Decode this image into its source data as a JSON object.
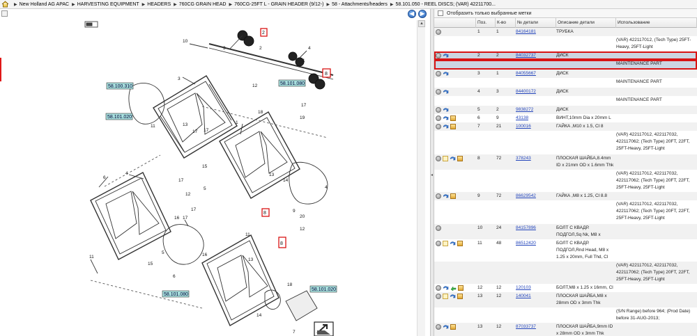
{
  "breadcrumb": [
    "New Holland AG APAC",
    "HARVESTING EQUIPMENT",
    "HEADERS",
    "760CG GRAIN HEAD",
    "760CG-25FT L - GRAIN HEADER (9/12-)",
    "58 - Attachments/headers",
    "58.101.050 - REEL DISCS; (VAR) 42211700..."
  ],
  "nav": {
    "back": "◀",
    "forward": "▶"
  },
  "diagram": {
    "refs": [
      "58.100.310",
      "58.101.080",
      "58.101.020",
      "58.101.080",
      "58.101.020"
    ],
    "callouts": [
      "2",
      "8",
      "8",
      "8"
    ],
    "numbers": [
      "10",
      "3",
      "2",
      "4",
      "1",
      "3",
      "1",
      "18",
      "19",
      "11",
      "13",
      "17",
      "12",
      "17",
      "17",
      "15",
      "5",
      "13",
      "14",
      "4",
      "6",
      "17",
      "12",
      "17",
      "17",
      "16",
      "5",
      "11",
      "6",
      "16",
      "15",
      "11",
      "20",
      "4",
      "18",
      "9",
      "12",
      "13",
      "14",
      "7"
    ]
  },
  "filter": {
    "label": "Отобразить только выбранные метки"
  },
  "columns": [
    "Поз.",
    "К-во",
    "№ детали",
    "Описание детали",
    "Использование"
  ],
  "rows": [
    {
      "pos": "1",
      "qty": "1",
      "pn": "84164181",
      "desc": "ТРУБКА",
      "use": "",
      "icons": [
        "grey"
      ],
      "h": 12,
      "bg": "r0"
    },
    {
      "pos": "",
      "qty": "",
      "pn": "",
      "desc": "",
      "use": "(VAR) 422117012, (Tech Type) 25FT-Heavy, 25FT-Light",
      "icons": [],
      "h": 22,
      "bg": "r1"
    },
    {
      "pos": "2",
      "qty": "2",
      "pn": "84032737",
      "desc": "ДИСК",
      "use": "",
      "icons": [
        "grey",
        "blue"
      ],
      "h": 12,
      "bg": "sel"
    },
    {
      "pos": "",
      "qty": "",
      "pn": "",
      "desc": "",
      "use": "MAINTENANCE PART",
      "icons": [],
      "h": 14,
      "bg": "sel"
    },
    {
      "pos": "3",
      "qty": "1",
      "pn": "84055667",
      "desc": "ДИСК",
      "use": "",
      "icons": [
        "grey",
        "blue"
      ],
      "h": 12,
      "bg": "r0"
    },
    {
      "pos": "",
      "qty": "",
      "pn": "",
      "desc": "",
      "use": "MAINTENANCE PART",
      "icons": [],
      "h": 14,
      "bg": "r1"
    },
    {
      "pos": "4",
      "qty": "3",
      "pn": "84400172",
      "desc": "ДИСК",
      "use": "",
      "icons": [
        "grey",
        "blue"
      ],
      "h": 12,
      "bg": "r0"
    },
    {
      "pos": "",
      "qty": "",
      "pn": "",
      "desc": "",
      "use": "MAINTENANCE PART",
      "icons": [],
      "h": 14,
      "bg": "r1"
    },
    {
      "pos": "5",
      "qty": "2",
      "pn": "9838272",
      "desc": "ДИСК",
      "use": "",
      "icons": [
        "grey",
        "blue"
      ],
      "h": 12,
      "bg": "r0"
    },
    {
      "pos": "6",
      "qty": "9",
      "pn": "43138",
      "desc": "ВИНТ,10mm Dia x 20mm L",
      "use": "",
      "icons": [
        "grey",
        "blue",
        "box"
      ],
      "h": 12,
      "bg": "r1"
    },
    {
      "pos": "7",
      "qty": "21",
      "pn": "100016",
      "desc": "ГАЙКА ,M10 x 1.5, Cl 8",
      "use": "",
      "icons": [
        "grey",
        "blue",
        "box"
      ],
      "h": 12,
      "bg": "r0"
    },
    {
      "pos": "",
      "qty": "",
      "pn": "",
      "desc": "",
      "use": "(VAR) 422117012, 422117032, 422117062; (Tech Type) 20FT, 22FT, 25FT-Heavy, 25FT-Light",
      "icons": [],
      "h": 34,
      "bg": "r1"
    },
    {
      "pos": "8",
      "qty": "72",
      "pn": "378243",
      "desc": "ПЛОСКАЯ ШАЙБА,8.4mm ID x 21mm OD x 1.6mm Thk",
      "use": "",
      "icons": [
        "grey",
        "note",
        "blue",
        "box"
      ],
      "h": 22,
      "bg": "r0"
    },
    {
      "pos": "",
      "qty": "",
      "pn": "",
      "desc": "",
      "use": "(VAR) 422117012, 422117032, 422117062; (Tech Type) 20FT, 22FT, 25FT-Heavy, 25FT-Light",
      "icons": [],
      "h": 32,
      "bg": "r1"
    },
    {
      "pos": "9",
      "qty": "72",
      "pn": "86629542",
      "desc": "ГАЙКА ,M8 x 1.25, Cl 8.8",
      "use": "",
      "icons": [
        "grey",
        "blue",
        "box"
      ],
      "h": 12,
      "bg": "r0"
    },
    {
      "pos": "",
      "qty": "",
      "pn": "",
      "desc": "",
      "use": "(VAR) 422117012, 422117032, 422117062; (Tech Type) 20FT, 22FT, 25FT-Heavy, 25FT-Light",
      "icons": [],
      "h": 34,
      "bg": "r1"
    },
    {
      "pos": "10",
      "qty": "24",
      "pn": "84157896",
      "desc": "БОЛТ С КВАДР. ПОДГОЛ,Sq Nk, M8 x 22mm, Cl 8.8, Full Thd",
      "use": "",
      "icons": [
        "grey"
      ],
      "h": 22,
      "bg": "r0"
    },
    {
      "pos": "11",
      "qty": "48",
      "pn": "86512420",
      "desc": "БОЛТ С КВАДР. ПОДГОЛ,Rnd Head, M8 x 1.25 x 20mm, Full Thd, Cl 8.8",
      "use": "",
      "icons": [
        "grey",
        "note",
        "blue",
        "box"
      ],
      "h": 32,
      "bg": "r1"
    },
    {
      "pos": "",
      "qty": "",
      "pn": "",
      "desc": "",
      "use": "(VAR) 422117012, 422117032, 422117062; (Tech Type) 20FT, 22FT, 25FT-Heavy, 25FT-Light",
      "icons": [],
      "h": 32,
      "bg": "r0"
    },
    {
      "pos": "12",
      "qty": "12",
      "pn": "120103",
      "desc": "БОЛТ,M8 x 1.25 x 16mm, Cl 8.8",
      "use": "",
      "icons": [
        "grey",
        "blue",
        "green",
        "box"
      ],
      "h": 12,
      "bg": "r1"
    },
    {
      "pos": "13",
      "qty": "12",
      "pn": "140041",
      "desc": "ПЛОСКАЯ ШАЙБА,M8 x 28mm OD x 3mm Thk",
      "use": "",
      "icons": [
        "grey",
        "note",
        "blue",
        "box"
      ],
      "h": 22,
      "bg": "r0"
    },
    {
      "pos": "",
      "qty": "",
      "pn": "",
      "desc": "",
      "use": "(S/N Range) before 964; (Prod Date) before 31-AUG-2013;",
      "icons": [],
      "h": 22,
      "bg": "r1"
    },
    {
      "pos": "13",
      "qty": "12",
      "pn": "87033737",
      "desc": "ПЛОСКАЯ ШАЙБА,9mm ID x 28mm OD x 3mm Thk",
      "use": "",
      "icons": [
        "grey",
        "blue",
        "box"
      ],
      "h": 22,
      "bg": "r0"
    }
  ],
  "colors": {
    "selection": "#ccd6e2",
    "highlight": "#d81414",
    "link": "#2244bb",
    "refbox": "#a8e0de"
  }
}
